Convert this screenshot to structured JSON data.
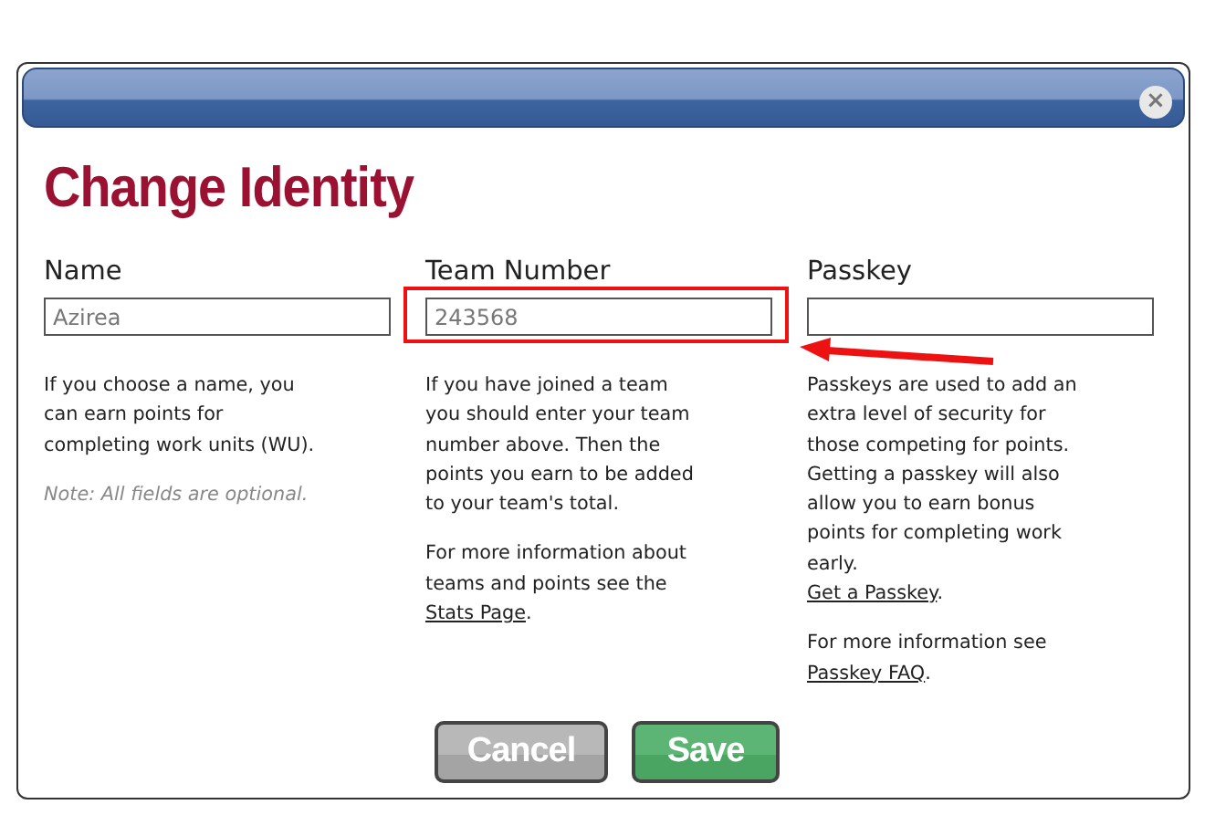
{
  "dialog": {
    "title": "Change Identity",
    "close": "×"
  },
  "columns": [
    {
      "label": "Name",
      "value": "Azirea",
      "highlighted": false,
      "paragraphs": [
        [
          {
            "kind": "text",
            "text": "If you choose a name, you can earn points for completing work units (WU)."
          }
        ],
        [
          {
            "kind": "note",
            "text": "Note: All fields are optional."
          }
        ]
      ]
    },
    {
      "label": "Team Number",
      "value": "243568",
      "highlighted": true,
      "paragraphs": [
        [
          {
            "kind": "text",
            "text": "If you have joined a team you should enter your team number above. Then the points you earn to be added to your team's total."
          }
        ],
        [
          {
            "kind": "text",
            "text": "For more information about teams and points see the "
          },
          {
            "kind": "link",
            "text": "Stats Page"
          },
          {
            "kind": "text",
            "text": "."
          }
        ]
      ]
    },
    {
      "label": "Passkey",
      "highlighted": false,
      "paragraphs": [
        [
          {
            "kind": "text",
            "text": "Passkeys are used to add an extra level of security for those competing for points. Getting a passkey will also allow you to earn bonus points for completing work early."
          },
          {
            "kind": "break"
          },
          {
            "kind": "link",
            "text": "Get a Passkey"
          },
          {
            "kind": "text",
            "text": "."
          }
        ],
        [
          {
            "kind": "text",
            "text": "For more information see "
          },
          {
            "kind": "break"
          },
          {
            "kind": "link",
            "text": "Passkey FAQ"
          },
          {
            "kind": "text",
            "text": "."
          }
        ]
      ]
    }
  ],
  "buttons": [
    {
      "label": "Cancel",
      "kind": "cancel"
    },
    {
      "label": "Save",
      "kind": "save"
    }
  ],
  "annotation": {
    "kind": "arrow"
  }
}
